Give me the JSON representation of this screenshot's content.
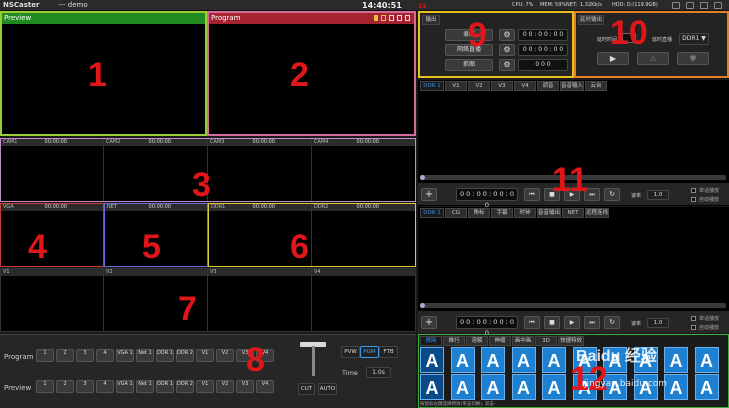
{
  "app": {
    "logo": "NSCaster",
    "doc": "--- demo",
    "clock": "14:40:51",
    "stats": [
      "CPU: 7%",
      "MEM: 59%",
      "NET:",
      "1.32Kb/s",
      "HDD: D:(119.9GB)"
    ]
  },
  "preview": {
    "title": "Preview",
    "number": "1",
    "border": "#9acd32",
    "header_bg": "#1f8a1f"
  },
  "program": {
    "title": "Program",
    "number": "2",
    "border": "#d36b9b",
    "header_bg": "#a52430"
  },
  "cams": {
    "items": [
      {
        "label": "CAM1",
        "time": "00:00:00"
      },
      {
        "label": "CAM2",
        "time": "00:00:00"
      },
      {
        "label": "CAM3",
        "time": "00:00:00"
      },
      {
        "label": "CAM4",
        "time": "00:00:00"
      }
    ],
    "number": "3",
    "border": "#c08cc8"
  },
  "row2": {
    "items": [
      {
        "label": "VGA",
        "time": "00:00:00",
        "border": "#c83e3e"
      },
      {
        "label": "NET",
        "time": "00:00:00",
        "border": "#6a6ad8"
      },
      {
        "label": "DDR1",
        "time": "00:00:00",
        "border": "#d8c83a"
      },
      {
        "label": "DDR2",
        "time": "00:00:00",
        "border": "#d8c83a"
      }
    ],
    "numbers": [
      "4",
      "5",
      "6"
    ]
  },
  "row3": {
    "items": [
      "V1",
      "V2",
      "V3",
      "V4"
    ],
    "number": "7"
  },
  "switcher": {
    "number": "8",
    "program_label": "Program",
    "preview_label": "Preview",
    "buttons": [
      "1",
      "2",
      "3",
      "4",
      "VGA 1",
      "Net 1",
      "DDR 1",
      "DDR 2",
      "V1",
      "V2",
      "V3",
      "V4"
    ],
    "mode": [
      "PVW",
      "PGM",
      "FTB"
    ],
    "time_label": "Time",
    "time_value": "1.0s",
    "cut": "CUT",
    "auto": "AUTO"
  },
  "output": {
    "number": "9",
    "tab": "输出",
    "rows": [
      {
        "label": "录制",
        "time": "0 0 : 0 0 : 0 0"
      },
      {
        "label": "网络直播",
        "time": "0 0 : 0 0 : 0 0"
      },
      {
        "label": "抓图",
        "time": "0 0 0"
      }
    ]
  },
  "delay": {
    "number": "10",
    "tab": "延时输出",
    "label1": "延时时间",
    "label2": "延时直播",
    "select": "DDR1",
    "button_icons": [
      "play-icon",
      "warning-icon",
      "shield-icon"
    ]
  },
  "ddr1": {
    "tabs": [
      "DDR 1",
      "V1",
      "V2",
      "V3",
      "V4",
      "调音",
      "音音输入",
      "云台"
    ],
    "number": "11",
    "timecode": "0 0 : 0 0 : 0 0 : 0 0",
    "speed_label": "速率",
    "speed": "1.0",
    "opt1": "单话播放",
    "opt2": "自动播放"
  },
  "ddr2": {
    "tabs": [
      "DDR 2",
      "CG",
      "角标",
      "字幕",
      "时钟",
      "音音输出",
      "NET",
      "远程连线"
    ],
    "timecode": "0 0 : 0 0 : 0 0 : 0 0",
    "speed_label": "速率",
    "speed": "1.0",
    "opt1": "单话播放",
    "opt2": "自动播放"
  },
  "effects": {
    "number": "12",
    "tabs": [
      "擦除",
      "推行",
      "溶解",
      "伸缩",
      "画中画",
      "3D",
      "快捷特效"
    ],
    "count": 20,
    "glyph": "A",
    "status": "按鼠标左键选择特效(单击切换), 双击-"
  },
  "watermark": {
    "text": "Baidu 经验",
    "sub": "jingyan.baidu.com"
  }
}
